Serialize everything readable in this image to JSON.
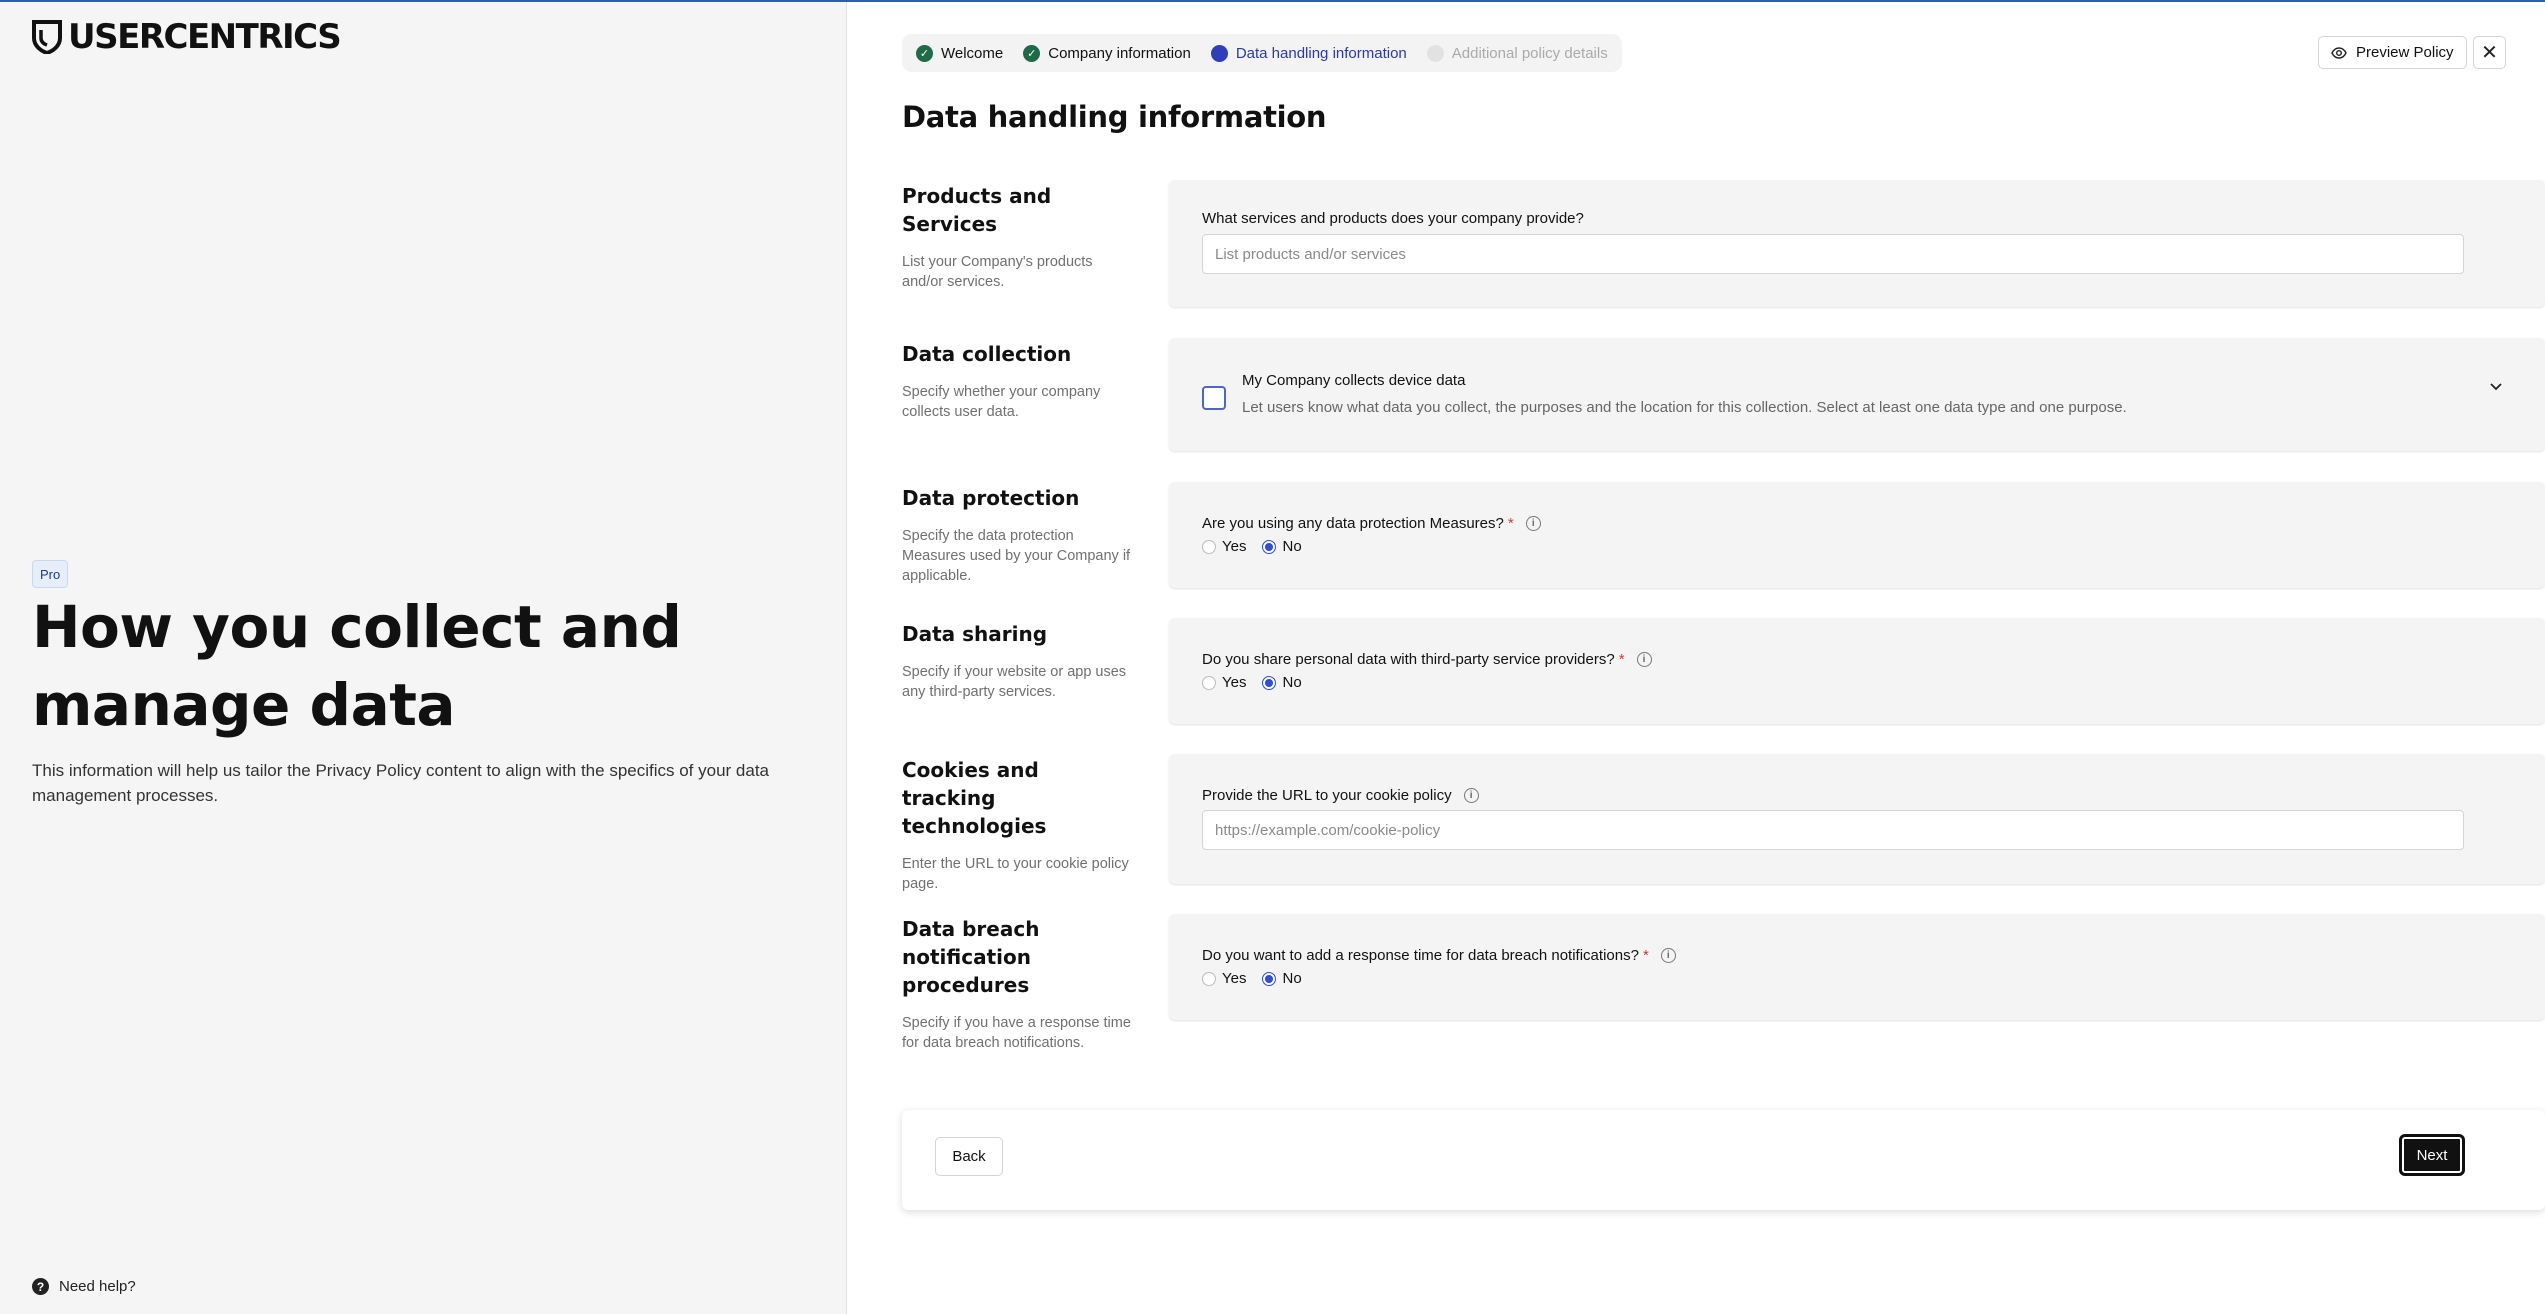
{
  "brand": {
    "logo_text": "USERCENTRICS"
  },
  "left_panel": {
    "badge": "Pro",
    "title": "How you collect and manage data",
    "description": "This information will help us tailor the Privacy Policy content to align with the specifics of your data management processes.",
    "help_label": "Need help?"
  },
  "stepper": [
    {
      "label": "Welcome",
      "state": "done"
    },
    {
      "label": "Company information",
      "state": "done"
    },
    {
      "label": "Data handling information",
      "state": "current"
    },
    {
      "label": "Additional policy details",
      "state": "todo"
    }
  ],
  "header": {
    "preview_label": "Preview Policy"
  },
  "page_title": "Data handling information",
  "sections": {
    "products": {
      "title": "Products and Services",
      "desc": "List your Company's products and/or services.",
      "question": "What services and products does your company provide?",
      "placeholder": "List products and/or services",
      "value": ""
    },
    "collection": {
      "title": "Data collection",
      "desc": "Specify whether your company collects user data.",
      "checkbox_title": "My Company collects device data",
      "checkbox_desc": "Let users know what data you collect, the purposes and the location for this collection. Select at least one data type and one purpose.",
      "checked": false
    },
    "protection": {
      "title": "Data protection",
      "desc": "Specify the data protection Measures used by your Company if applicable.",
      "question": "Are you using any data protection Measures?",
      "required_mark": "*",
      "options": [
        "Yes",
        "No"
      ],
      "selected": "No"
    },
    "sharing": {
      "title": "Data sharing",
      "desc": "Specify if your website or app uses any third-party services.",
      "question": "Do you share personal data with third-party service providers?",
      "required_mark": "*",
      "options": [
        "Yes",
        "No"
      ],
      "selected": "No"
    },
    "cookies": {
      "title": "Cookies and tracking technologies",
      "desc": "Enter the URL to your cookie policy page.",
      "question": "Provide the URL to your cookie policy",
      "placeholder": "https://example.com/cookie-policy",
      "value": ""
    },
    "breach": {
      "title": "Data breach notification procedures",
      "desc": "Specify if you have a response time for data breach notifications.",
      "question": "Do you want to add a response time for data breach notifications?",
      "required_mark": "*",
      "options": [
        "Yes",
        "No"
      ],
      "selected": "No"
    }
  },
  "footer": {
    "back_label": "Back",
    "next_label": "Next"
  },
  "colors": {
    "accent": "#2f4fd8",
    "step_done": "#1f6b47",
    "step_current": "#2f3fb9",
    "required": "#d23a3a"
  }
}
